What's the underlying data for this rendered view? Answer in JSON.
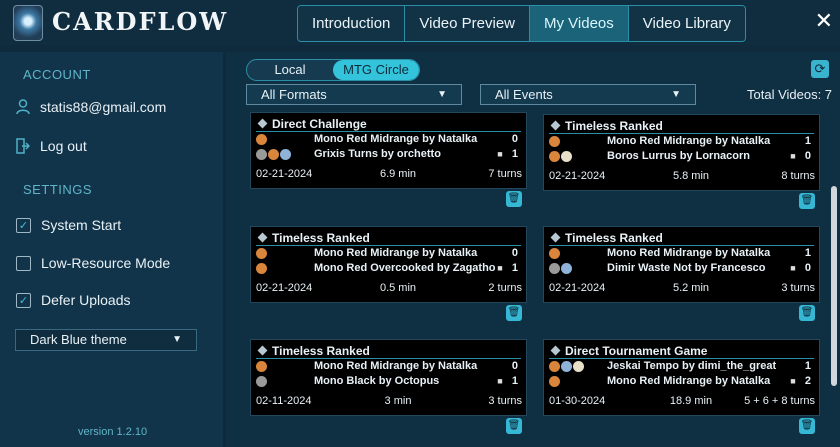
{
  "app": {
    "title": "CARDFLOW",
    "close_glyph": "✕"
  },
  "tabs": [
    {
      "label": "Introduction",
      "active": false
    },
    {
      "label": "Video Preview",
      "active": false
    },
    {
      "label": "My Videos",
      "active": true
    },
    {
      "label": "Video Library",
      "active": false
    }
  ],
  "sidebar": {
    "account_header": "ACCOUNT",
    "email": "statis88@gmail.com",
    "logout": "Log out",
    "settings_header": "SETTINGS",
    "options": [
      {
        "label": "System Start",
        "checked": true
      },
      {
        "label": "Low-Resource Mode",
        "checked": false
      },
      {
        "label": "Defer Uploads",
        "checked": true
      }
    ],
    "theme": "Dark Blue theme",
    "version": "version 1.2.10"
  },
  "main": {
    "source_toggle": {
      "local": "Local",
      "circle": "MTG Circle",
      "active": "MTG Circle"
    },
    "formats_filter": "All Formats",
    "events_filter": "All Events",
    "total_videos": "Total Videos: 7",
    "cards": [
      {
        "title": "Direct Challenge",
        "players": [
          {
            "colors": [
              "red"
            ],
            "name": "Mono Red Midrange by Natalka",
            "score": "0",
            "marker": ""
          },
          {
            "colors": [
              "black",
              "red",
              "blue"
            ],
            "name": "Grixis Turns by orchetto",
            "score": "1",
            "marker": "■"
          }
        ],
        "date": "02-21-2024",
        "duration": "6.9 min",
        "turns": "7 turns"
      },
      {
        "title": "Timeless Ranked",
        "players": [
          {
            "colors": [
              "red"
            ],
            "name": "Mono Red Midrange by Natalka",
            "score": "1",
            "marker": ""
          },
          {
            "colors": [
              "red",
              "white"
            ],
            "name": "Boros Lurrus by Lornacorn",
            "score": "0",
            "marker": "■"
          }
        ],
        "date": "02-21-2024",
        "duration": "5.8 min",
        "turns": "8 turns"
      },
      {
        "title": "Timeless Ranked",
        "players": [
          {
            "colors": [
              "red"
            ],
            "name": "Mono Red Midrange by Natalka",
            "score": "0",
            "marker": ""
          },
          {
            "colors": [
              "red"
            ],
            "name": "Mono Red Overcooked by Zagatho",
            "score": "1",
            "marker": "■"
          }
        ],
        "date": "02-21-2024",
        "duration": "0.5 min",
        "turns": "2 turns"
      },
      {
        "title": "Timeless Ranked",
        "players": [
          {
            "colors": [
              "red"
            ],
            "name": "Mono Red Midrange by Natalka",
            "score": "1",
            "marker": ""
          },
          {
            "colors": [
              "black",
              "blue"
            ],
            "name": "Dimir Waste Not by Francesco",
            "score": "0",
            "marker": "■"
          }
        ],
        "date": "02-21-2024",
        "duration": "5.2 min",
        "turns": "3 turns"
      },
      {
        "title": "Timeless Ranked",
        "players": [
          {
            "colors": [
              "red"
            ],
            "name": "Mono Red Midrange by Natalka",
            "score": "0",
            "marker": ""
          },
          {
            "colors": [
              "black"
            ],
            "name": "Mono Black by Octopus",
            "score": "1",
            "marker": "■"
          }
        ],
        "date": "02-11-2024",
        "duration": "3 min",
        "turns": "3 turns"
      },
      {
        "title": "Direct Tournament Game",
        "players": [
          {
            "colors": [
              "red",
              "blue",
              "white"
            ],
            "name": "Jeskai Tempo by dimi_the_great",
            "score": "1",
            "marker": ""
          },
          {
            "colors": [
              "red"
            ],
            "name": "Mono Red Midrange by Natalka",
            "score": "2",
            "marker": "■"
          }
        ],
        "date": "01-30-2024",
        "duration": "18.9 min",
        "turns": "5 + 6 + 8 turns"
      }
    ]
  },
  "icons": {
    "user": "user-icon",
    "logout": "logout-icon",
    "refresh": "refresh-icon",
    "trash": "trash-icon",
    "chevron": "chevron-down-icon",
    "format": "diamond-icon"
  }
}
